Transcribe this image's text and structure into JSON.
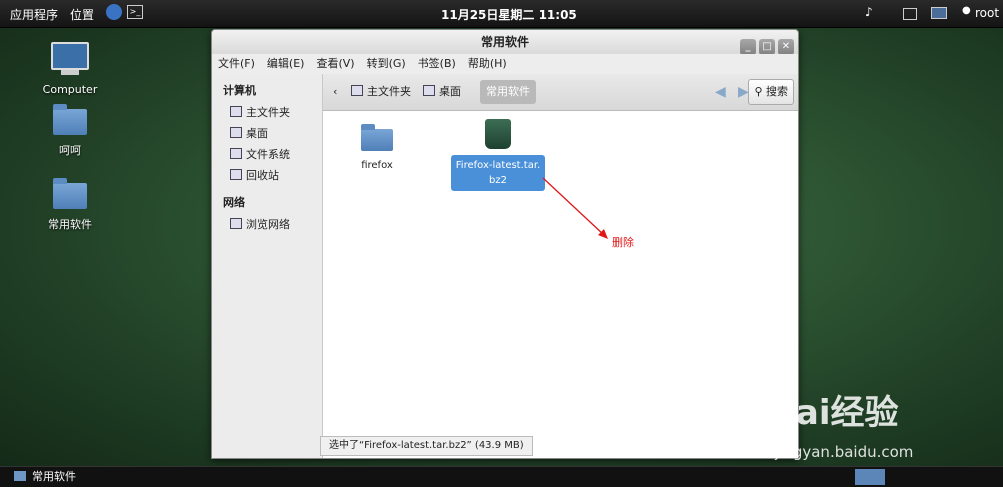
{
  "top_panel": {
    "applications": "应用程序",
    "places": "位置",
    "clock": "11月25日星期二 11:05",
    "user": "root"
  },
  "desktop": {
    "icons": [
      "Computer",
      "呵呵",
      "常用软件"
    ]
  },
  "window": {
    "title": "常用软件",
    "menu": [
      "文件(F)",
      "编辑(E)",
      "查看(V)",
      "转到(G)",
      "书签(B)",
      "帮助(H)"
    ],
    "sidebar": {
      "computer_heading": "计算机",
      "computer_items": [
        "主文件夹",
        "桌面",
        "文件系统",
        "回收站"
      ],
      "network_heading": "网络",
      "network_items": [
        "浏览网络"
      ]
    },
    "breadcrumbs": [
      "主文件夹",
      "桌面",
      "常用软件"
    ],
    "search_label": "搜索",
    "files": [
      {
        "name": "firefox",
        "type": "folder"
      },
      {
        "name": "Firefox-latest.tar.bz2",
        "type": "archive",
        "selected": true
      }
    ],
    "status": "选中了“Firefox-latest.tar.bz2” (43.9 MB)"
  },
  "annotation": "删除",
  "taskbar": {
    "task": "常用软件"
  },
  "watermark": {
    "brand": "Bai经验",
    "url": "jingyan.baidu.com"
  }
}
